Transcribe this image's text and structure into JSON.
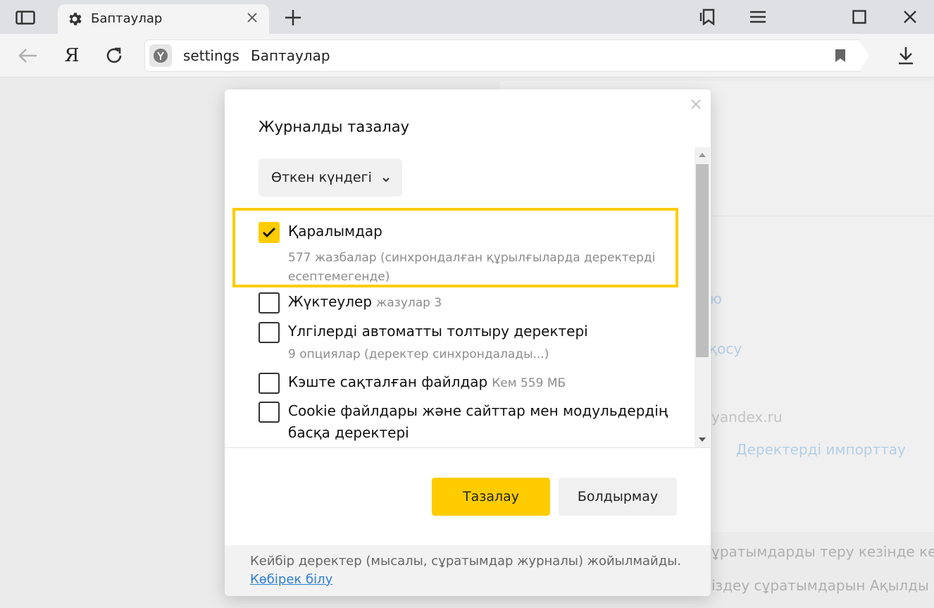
{
  "browser": {
    "tab_title": "Баптаулар",
    "yandex_letter": "Я",
    "url_host": "settings",
    "url_title": "Баптаулар"
  },
  "background": {
    "frag_1": "ю",
    "frag_2": "қосу",
    "frag_3": "yandex.ru",
    "frag_4": "Деректерді импорттау",
    "frag_5": "ұратымдарды теру кезінде кең",
    "frag_6": "іздеу сұратымдарын Ақылды ж"
  },
  "dialog": {
    "title": "Журналды тазалау",
    "period": "Өткен күндегі",
    "items": [
      {
        "label": "Қаралымдар",
        "count": "",
        "desc": "577 жазбалар (синхрондалған құрылғыларда деректерді есептемегенде)",
        "checked": true
      },
      {
        "label": "Жүктеулер",
        "count": "жазулар 3",
        "desc": "",
        "checked": false
      },
      {
        "label": "Үлгілерді автоматты толтыру деректері",
        "count": "",
        "desc": "9 опциялар (деректер синхрондалады...)",
        "checked": false
      },
      {
        "label": "Кэште сақталған файлдар",
        "count": "Кем 559 МБ",
        "desc": "",
        "checked": false
      },
      {
        "label": "Cookie файлдары және сайттар мен модульдердің",
        "label2": "басқа деректері",
        "count": "",
        "desc": "",
        "checked": false
      }
    ],
    "clear_label": "Тазалау",
    "cancel_label": "Болдырмау",
    "footer_text": "Кейбір деректер (мысалы, сұратымдар журналы) жойылмайды.",
    "footer_link": "Көбірек білу"
  },
  "colors": {
    "accent": "#ffcc00",
    "link": "#2f7fd0"
  }
}
